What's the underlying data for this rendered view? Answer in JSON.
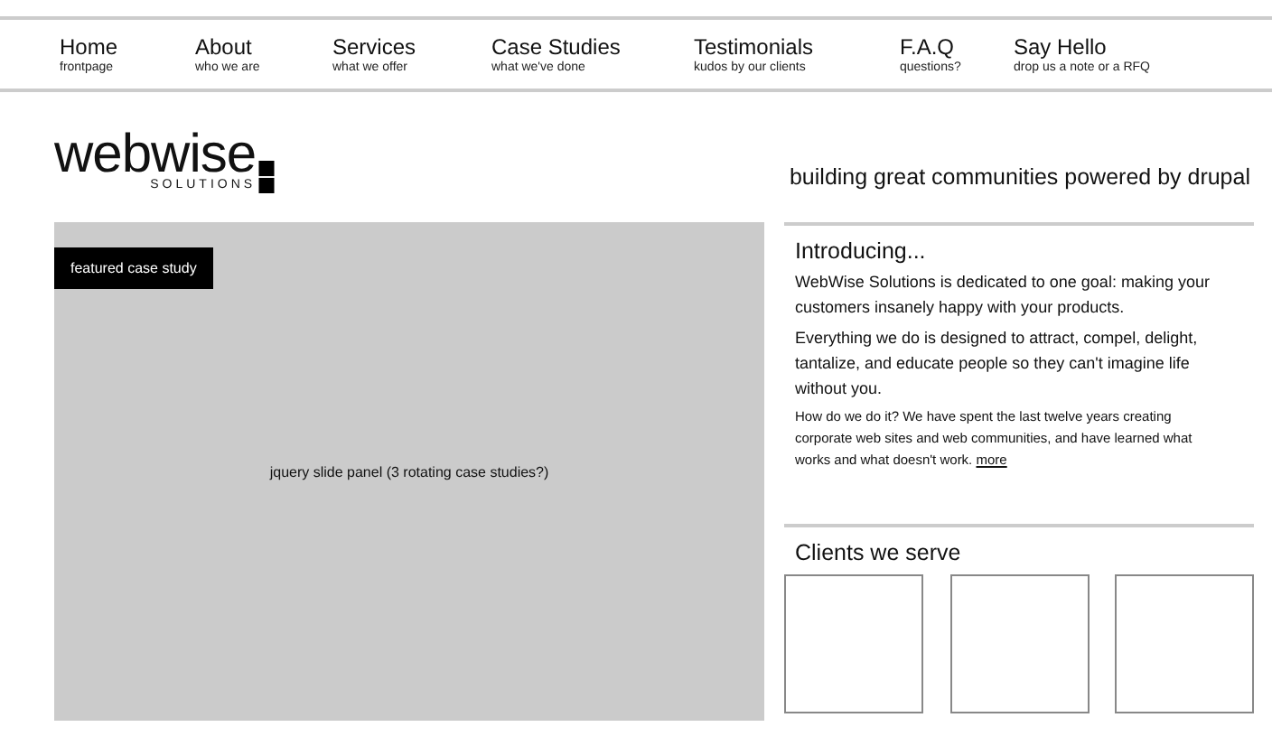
{
  "nav": [
    {
      "label": "Home",
      "sub": "frontpage"
    },
    {
      "label": "About",
      "sub": "who we are"
    },
    {
      "label": "Services",
      "sub": "what we offer"
    },
    {
      "label": "Case Studies",
      "sub": "what we've done"
    },
    {
      "label": "Testimonials",
      "sub": "kudos by our clients"
    },
    {
      "label": "F.A.Q",
      "sub": "questions?"
    },
    {
      "label": "Say Hello",
      "sub": "drop us a note or a RFQ"
    }
  ],
  "logo": {
    "name": "webwise",
    "sub": "SOLUTIONS"
  },
  "tagline": "building great communities powered by drupal",
  "slide_panel": {
    "badge": "featured case study",
    "placeholder_text": "jquery slide panel (3 rotating case studies?)"
  },
  "intro": {
    "title": "Introducing...",
    "paragraphs": [
      "WebWise Solutions is dedicated to one goal: making your customers insanely happy with your products.",
      "Everything we do is designed to attract, compel, delight, tantalize, and educate people so they can't imagine life without you."
    ],
    "small_text": "How do we do it? We have spent the last twelve years creating corporate web sites and web communities, and have learned what works and what doesn't work.",
    "more_link": "more"
  },
  "clients": {
    "title": "Clients we serve",
    "logos": [
      {
        "kind": "placeholder"
      },
      {
        "kind": "placeholder"
      },
      {
        "kind": "placeholder"
      }
    ]
  }
}
